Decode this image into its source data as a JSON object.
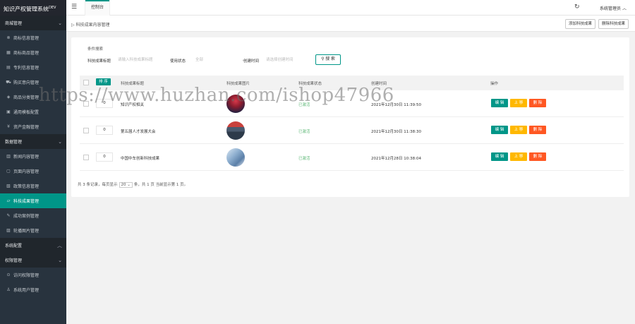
{
  "app": {
    "title": "知识产权管理系统",
    "version": "DEV"
  },
  "sidebar": {
    "groups": [
      {
        "label": "商城管理",
        "expanded": true,
        "items": [
          {
            "label": "商标信息管理",
            "icon": "circle-icon"
          },
          {
            "label": "商标商品管理",
            "icon": "grid-icon"
          },
          {
            "label": "专利信息管理",
            "icon": "doc-icon"
          },
          {
            "label": "购买意向管理",
            "icon": "cart-icon"
          },
          {
            "label": "商品分类管理",
            "icon": "tag-icon"
          },
          {
            "label": "通用模板配置",
            "icon": "template-icon"
          },
          {
            "label": "资产金融管理",
            "icon": "money-icon"
          }
        ]
      },
      {
        "label": "数据管理",
        "expanded": true,
        "items": [
          {
            "label": "新闻内容管理",
            "icon": "news-icon"
          },
          {
            "label": "页面内容管理",
            "icon": "page-icon"
          },
          {
            "label": "政策信息管理",
            "icon": "policy-icon"
          },
          {
            "label": "科技成果管理",
            "icon": "chart-icon",
            "active": true
          },
          {
            "label": "成功案例管理",
            "icon": "pen-icon"
          },
          {
            "label": "轮播图片管理",
            "icon": "image-icon"
          }
        ]
      },
      {
        "label": "系统配置",
        "expanded": false,
        "items": []
      },
      {
        "label": "权限管理",
        "expanded": true,
        "items": [
          {
            "label": "访问权限管理",
            "icon": "lock-icon"
          },
          {
            "label": "系统用户管理",
            "icon": "user-icon"
          }
        ]
      }
    ]
  },
  "topbar": {
    "tab": "控制台",
    "user": "系统管理员"
  },
  "breadcrumb": "科技成果内容管理",
  "header_buttons": {
    "add": "添加科技成果",
    "delete": "删除科技成果"
  },
  "filter": {
    "title": "条件搜索",
    "name_label": "科技成果标题",
    "name_placeholder": "请输入科技成果标题",
    "status_label": "使用状态",
    "status_value": "全部",
    "time_label": "创建时间",
    "time_placeholder": "请选择创建时间",
    "search_button": "搜 索"
  },
  "table": {
    "sort_button": "排 序",
    "columns": [
      "科技成果标题",
      "科技成果图片",
      "科技成果状态",
      "创建时间",
      "操作"
    ],
    "rows": [
      {
        "sort": "0",
        "title": "知识产权相关",
        "status": "已激活",
        "time": "2021年12月30日 11:39:50",
        "thumb": "stage"
      },
      {
        "sort": "0",
        "title": "第五届人才发展大会",
        "status": "已激活",
        "time": "2021年12月30日 11:38:30",
        "thumb": "meeting"
      },
      {
        "sort": "0",
        "title": "中国中车创新科技成果",
        "status": "已激活",
        "time": "2021年12月28日 10:38:04",
        "thumb": "building"
      }
    ],
    "actions": {
      "edit": "编 辑",
      "up": "上 移",
      "delete": "删 除"
    }
  },
  "pager": {
    "text_pre": "共 3 条记录，每页显示",
    "per_page": "20",
    "text_post": "条，共 1 页 当前显示第 1 页。"
  },
  "watermark": "https://www.huzhan.com/ishop47966",
  "colors": {
    "accent": "#009688",
    "sidebar_bg": "#28333e",
    "warn": "#ffb800",
    "danger": "#ff5722",
    "ok": "#5fb878"
  }
}
